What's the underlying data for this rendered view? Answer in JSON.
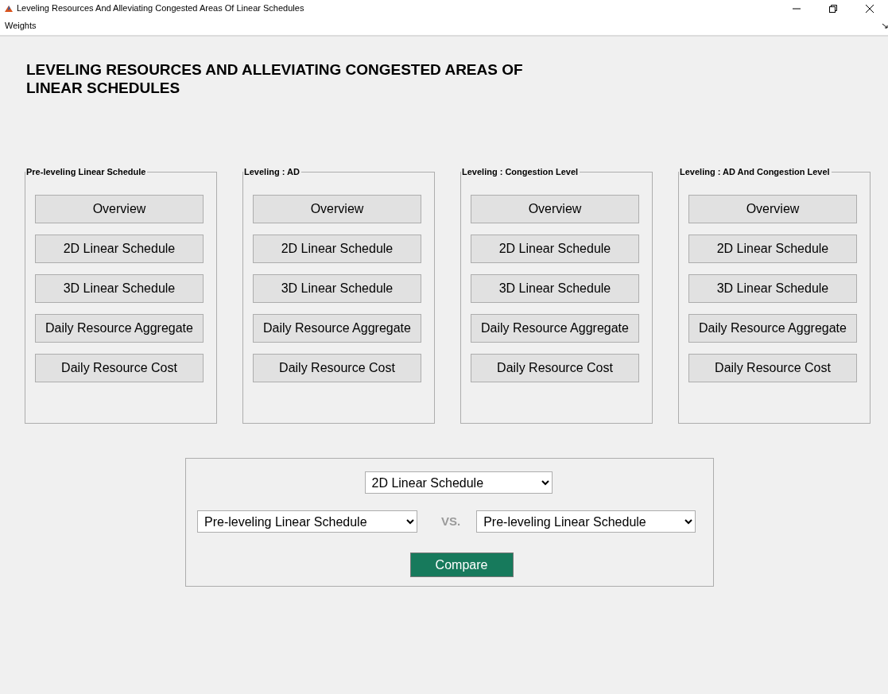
{
  "window": {
    "title": "Leveling Resources And Alleviating Congested Areas Of Linear Schedules"
  },
  "menu": [
    "Weights"
  ],
  "heading": "LEVELING RESOURCES AND ALLEVIATING CONGESTED AREAS OF LINEAR SCHEDULES",
  "panels": [
    {
      "title": "Pre-leveling Linear Schedule",
      "buttons": [
        "Overview",
        "2D Linear Schedule",
        "3D Linear Schedule",
        "Daily Resource Aggregate",
        "Daily Resource Cost"
      ]
    },
    {
      "title": "Leveling : AD",
      "buttons": [
        "Overview",
        "2D Linear Schedule",
        "3D Linear Schedule",
        "Daily Resource Aggregate",
        "Daily Resource Cost"
      ]
    },
    {
      "title": "Leveling : Congestion Level",
      "buttons": [
        "Overview",
        "2D Linear Schedule",
        "3D Linear Schedule",
        "Daily Resource Aggregate",
        "Daily Resource Cost"
      ]
    },
    {
      "title": "Leveling : AD And Congestion Level",
      "buttons": [
        "Overview",
        "2D Linear Schedule",
        "3D Linear Schedule",
        "Daily Resource Aggregate",
        "Daily Resource Cost"
      ]
    }
  ],
  "compare": {
    "view": {
      "value": "2D Linear Schedule"
    },
    "left": {
      "value": "Pre-leveling Linear Schedule"
    },
    "vs_label": "VS.",
    "right": {
      "value": "Pre-leveling Linear Schedule"
    },
    "button": "Compare"
  }
}
